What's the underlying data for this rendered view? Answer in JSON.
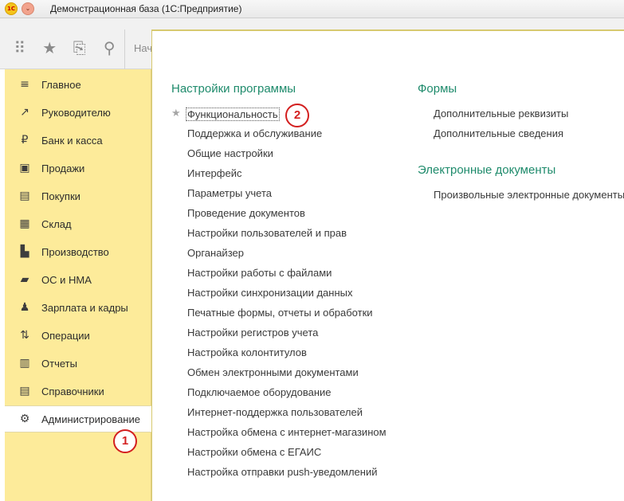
{
  "window": {
    "title": "Демонстрационная база  (1С:Предприятие)",
    "logo_text": "1С",
    "menu_glyph": "⌄"
  },
  "toolbar": {
    "start_label": "Нач",
    "icons": [
      "apps-grid-icon",
      "favorites-star-icon",
      "history-icon",
      "search-icon"
    ]
  },
  "sidebar": {
    "items": [
      {
        "label": "Главное",
        "icon": "menu-icon",
        "glyph": "≡"
      },
      {
        "label": "Руководителю",
        "icon": "trend-icon",
        "glyph": "↗"
      },
      {
        "label": "Банк и касса",
        "icon": "ruble-icon",
        "glyph": "₽"
      },
      {
        "label": "Продажи",
        "icon": "bag-icon",
        "glyph": "▣"
      },
      {
        "label": "Покупки",
        "icon": "cart-icon",
        "glyph": "▤"
      },
      {
        "label": "Склад",
        "icon": "warehouse-icon",
        "glyph": "▦"
      },
      {
        "label": "Производство",
        "icon": "factory-icon",
        "glyph": "▙"
      },
      {
        "label": "ОС и НМА",
        "icon": "truck-icon",
        "glyph": "▰"
      },
      {
        "label": "Зарплата и кадры",
        "icon": "people-icon",
        "glyph": "♟"
      },
      {
        "label": "Операции",
        "icon": "dt-kt-icon",
        "glyph": "⇅"
      },
      {
        "label": "Отчеты",
        "icon": "bar-chart-icon",
        "glyph": "▥"
      },
      {
        "label": "Справочники",
        "icon": "book-icon",
        "glyph": "▤"
      },
      {
        "label": "Администрирование",
        "icon": "gear-icon",
        "glyph": "⚙",
        "active": true
      }
    ]
  },
  "badges": {
    "one": "1",
    "two": "2"
  },
  "main": {
    "settings_title": "Настройки программы",
    "settings_links": [
      "Функциональность",
      "Поддержка и обслуживание",
      "Общие настройки",
      "Интерфейс",
      "Параметры учета",
      "Проведение документов",
      "Настройки пользователей и прав",
      "Органайзер",
      "Настройки работы с файлами",
      "Настройки синхронизации данных",
      "Печатные формы, отчеты и обработки",
      "Настройки регистров учета",
      "Настройка колонтитулов",
      "Обмен электронными документами",
      "Подключаемое оборудование",
      "Интернет-поддержка пользователей",
      "Настройка обмена с интернет-магазином",
      "Настройки обмена с ЕГАИС",
      "Настройка отправки push-уведомлений"
    ],
    "forms_title": "Формы",
    "forms_links": [
      "Дополнительные реквизиты",
      "Дополнительные сведения"
    ],
    "edocs_title": "Электронные документы",
    "edocs_links": [
      "Произвольные электронные документы"
    ]
  }
}
